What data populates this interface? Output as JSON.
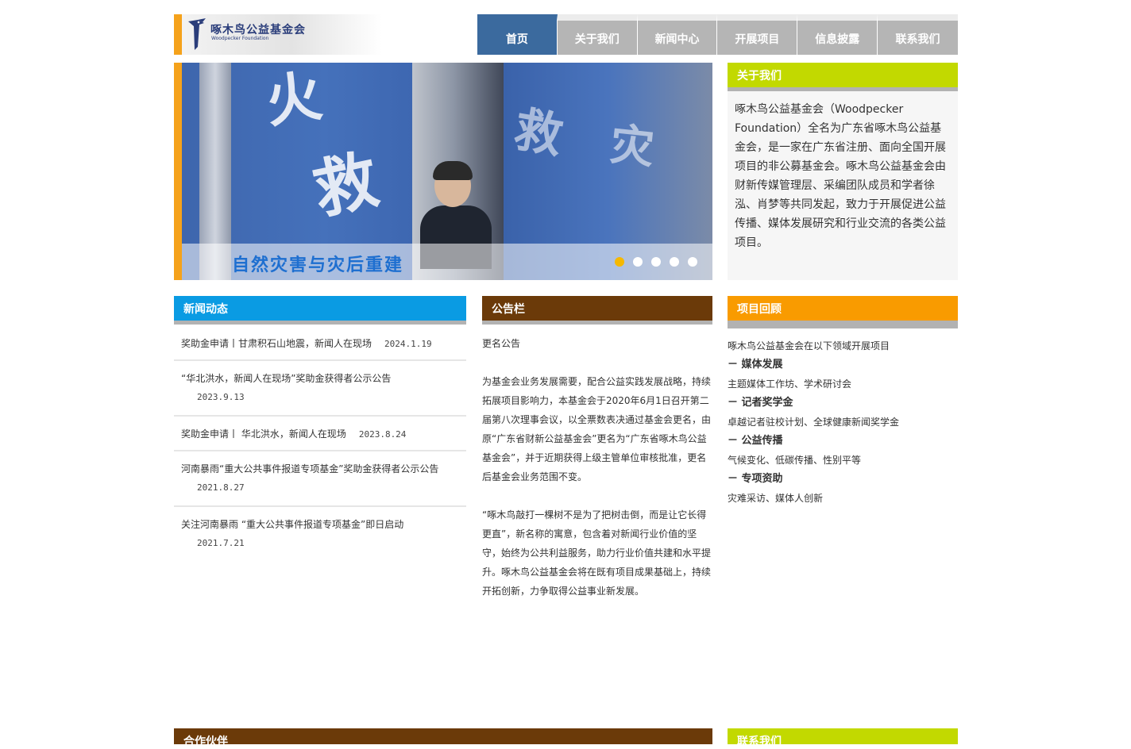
{
  "logo": {
    "name_cn": "啄木鸟公益基金会",
    "name_en": "Woodpecker Foundation"
  },
  "nav": [
    {
      "label": "首页",
      "active": true
    },
    {
      "label": "关于我们",
      "active": false
    },
    {
      "label": "新闻中心",
      "active": false
    },
    {
      "label": "开展项目",
      "active": false
    },
    {
      "label": "信息披露",
      "active": false
    },
    {
      "label": "联系我们",
      "active": false
    }
  ],
  "banner": {
    "caption": "自然灾害与灾后重建",
    "slide_count": 5,
    "current_slide": 1
  },
  "about": {
    "title": "关于我们",
    "text": "啄木鸟公益基金会（Woodpecker Foundation）全名为广东省啄木鸟公益基金会，是一家在广东省注册、面向全国开展项目的非公募基金会。啄木鸟公益基金会由财新传媒管理层、采编团队成员和学者徐泓、肖梦等共同发起，致力于开展促进公益传播、媒体发展研究和行业交流的各类公益项目。"
  },
  "news": {
    "title": "新闻动态",
    "items": [
      {
        "title": "奖助金申请丨甘肃积石山地震，新闻人在现场",
        "date": "2024.1.19"
      },
      {
        "title": "“华北洪水，新闻人在现场”奖助金获得者公示公告",
        "date": "2023.9.13"
      },
      {
        "title": "奖助金申请丨 华北洪水，新闻人在现场",
        "date": "2023.8.24"
      },
      {
        "title": "河南暴雨“重大公共事件报道专项基金”奖助金获得者公示公告",
        "date": "2021.8.27"
      },
      {
        "title": "关注河南暴雨 “重大公共事件报道专项基金”即日启动",
        "date": "2021.7.21"
      }
    ]
  },
  "notice": {
    "title": "公告栏",
    "paragraphs": [
      "更名公告",
      "为基金会业务发展需要，配合公益实践发展战略，持续拓展项目影响力，本基金会于2020年6月1日召开第二届第八次理事会议，以全票数表决通过基金会更名，由原“广东省财新公益基金会”更名为“广东省啄木鸟公益基金会”，并于近期获得上级主管单位审核批准，更名后基金会业务范围不变。",
      "“啄木鸟敲打一棵树不是为了把树击倒，而是让它长得更直”，新名称的寓意，包含着对新闻行业价值的坚守，始终为公共利益服务，助力行业价值共建和水平提升。啄木鸟公益基金会将在既有项目成果基础上，持续开拓创新，力争取得公益事业新发展。"
    ]
  },
  "projects": {
    "title": "项目回顾",
    "intro": "啄木鸟公益基金会在以下领域开展项目",
    "areas": [
      {
        "heading": "－ 媒体发展",
        "detail": "主题媒体工作坊、学术研讨会"
      },
      {
        "heading": "－ 记者奖学金",
        "detail": "卓越记者驻校计划、全球健康新闻奖学金"
      },
      {
        "heading": "－ 公益传播",
        "detail": "气候变化、低碳传播、性别平等"
      },
      {
        "heading": "－ 专项资助",
        "detail": "灾难采访、媒体人创新"
      }
    ]
  },
  "partners": {
    "title": "合作伙伴"
  },
  "contact": {
    "title": "联系我们"
  },
  "colors": {
    "accent_orange": "#f5a21b",
    "nav_active": "#3b6a9e",
    "nav_inactive": "#b5b5b5",
    "about_header": "#c2d900",
    "news_header": "#0a9be3",
    "notice_header": "#6b3a09",
    "projects_header": "#f99b00",
    "dot_active": "#f5b800"
  }
}
